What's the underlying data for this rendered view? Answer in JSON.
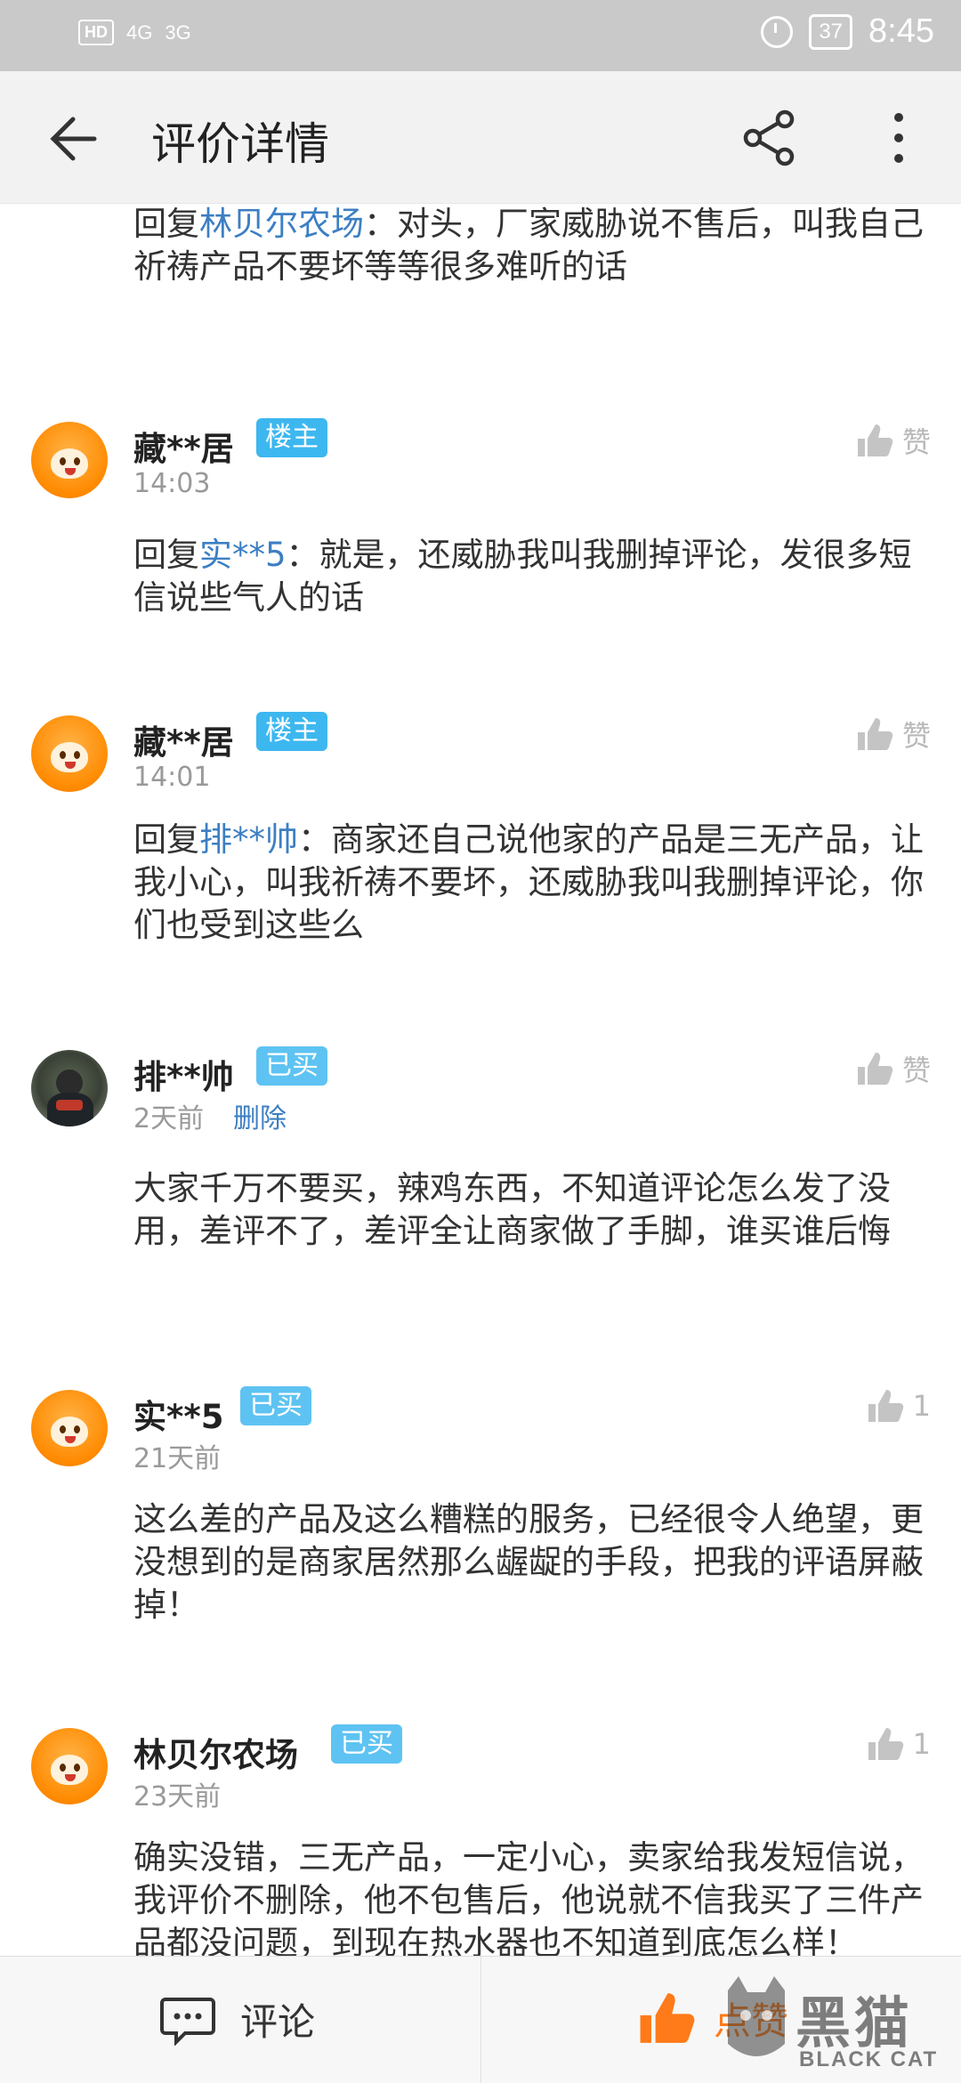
{
  "status_bar": {
    "left_icons": [
      "HD",
      "4G",
      "3G"
    ],
    "battery": "37",
    "time": "8:45"
  },
  "app_bar": {
    "title": "评价详情"
  },
  "top_reply": {
    "prefix": "回复",
    "target": "林贝尔农场",
    "text": "：对头，厂家威胁说不售后，叫我自己祈祷产品不要坏等等很多难听的话"
  },
  "comments": [
    {
      "username": "藏**居",
      "badge": "楼主",
      "time": "14:03",
      "like": "赞",
      "reply_prefix": "回复",
      "reply_target": "实**5",
      "text": "：就是，还威胁我叫我删掉评论，发很多短信说些气人的话"
    },
    {
      "username": "藏**居",
      "badge": "楼主",
      "time": "14:01",
      "like": "赞",
      "reply_prefix": "回复",
      "reply_target": "排**帅",
      "text": "：商家还自己说他家的产品是三无产品，让我小心，叫我祈祷不要坏，还威胁我叫我删掉评论，你们也受到这些么"
    },
    {
      "username": "排**帅",
      "badge": "已买",
      "time": "2天前",
      "delete": "删除",
      "like": "赞",
      "text": "大家千万不要买，辣鸡东西，不知道评论怎么发了没用，差评不了，差评全让商家做了手脚，谁买谁后悔"
    },
    {
      "username": "实**5",
      "badge": "已买",
      "time": "21天前",
      "like": "1",
      "text": "这么差的产品及这么糟糕的服务，已经很令人绝望，更没想到的是商家居然那么龌龊的手段，把我的评语屏蔽掉！"
    },
    {
      "username": "林贝尔农场",
      "badge": "已买",
      "time": "23天前",
      "like": "1",
      "text": "确实没错，三无产品，一定小心，卖家给我发短信说，我评价不删除，他不包售后，他说就不信我买了三件产品都没问题，到现在热水器也不知道到底怎么样！"
    }
  ],
  "bottom_bar": {
    "comment_label": "评论",
    "like_label": "点赞"
  },
  "watermark": {
    "cn": "黑猫",
    "en": "BLACK CAT"
  },
  "colors": {
    "link": "#3c7fc3",
    "badge": "#3db7ef",
    "like_active": "#ff7a18"
  }
}
